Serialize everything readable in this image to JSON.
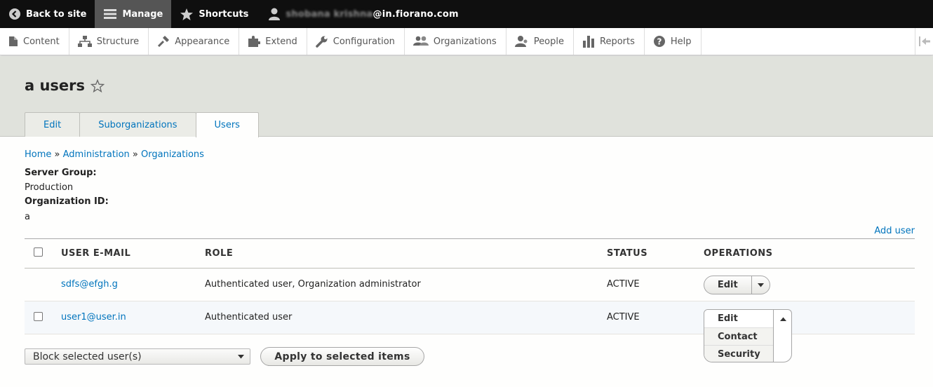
{
  "toolbar": {
    "back_label": "Back to site",
    "manage_label": "Manage",
    "shortcuts_label": "Shortcuts",
    "user_masked": "shobana krishna",
    "user_domain": "@in.fiorano.com"
  },
  "tray": {
    "items": [
      {
        "label": "Content",
        "icon": "file-icon"
      },
      {
        "label": "Structure",
        "icon": "sitemap-icon"
      },
      {
        "label": "Appearance",
        "icon": "paintbrush-icon"
      },
      {
        "label": "Extend",
        "icon": "puzzle-icon"
      },
      {
        "label": "Configuration",
        "icon": "wrench-icon"
      },
      {
        "label": "Organizations",
        "icon": "group-icon"
      },
      {
        "label": "People",
        "icon": "people-icon"
      },
      {
        "label": "Reports",
        "icon": "bar-chart-icon"
      },
      {
        "label": "Help",
        "icon": "help-icon"
      }
    ]
  },
  "page": {
    "title": "a users",
    "tabs": [
      "Edit",
      "Suborganizations",
      "Users"
    ],
    "active_tab": "Users"
  },
  "breadcrumb": {
    "home": "Home",
    "sep": "»",
    "administration": "Administration",
    "organizations": "Organizations"
  },
  "fields": {
    "server_group_label": "Server Group:",
    "server_group_value": "Production",
    "org_id_label": "Organization ID:",
    "org_id_value": "a"
  },
  "add_user_label": "Add user",
  "table": {
    "headers": {
      "email": "USER E-MAIL",
      "role": "ROLE",
      "status": "STATUS",
      "operations": "OPERATIONS"
    },
    "rows": [
      {
        "email": "sdfs@efgh.g",
        "role": "Authenticated user, Organization administrator",
        "status": "ACTIVE",
        "op": "Edit"
      },
      {
        "email": "user1@user.in",
        "role": "Authenticated user",
        "status": "ACTIVE",
        "op": "Edit"
      }
    ]
  },
  "dropdown_open": {
    "options": [
      "Edit",
      "Contact",
      "Security"
    ]
  },
  "bulk": {
    "selected_action": "Block selected user(s)",
    "apply_label": "Apply to selected items"
  },
  "colors": {
    "link": "#0074bd",
    "toolbar_bg": "#0f0f0f",
    "header_bg": "#e0e2dc"
  }
}
